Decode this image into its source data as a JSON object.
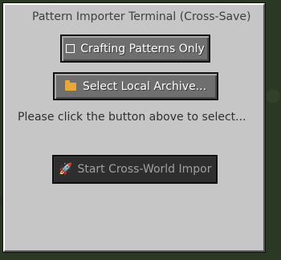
{
  "window": {
    "title": "Pattern Importer Terminal (Cross-Save)"
  },
  "buttons": {
    "toggle_label": "Crafting Patterns Only",
    "select_label": "Select Local Archive...",
    "start_label": "Start Cross-World Impor"
  },
  "status": {
    "text": "Please click the button above to select..."
  },
  "icons": {
    "toggle": "checkbox-icon",
    "select": "folder-icon",
    "start": "rocket-icon"
  },
  "colors": {
    "panel": "#c6c6c6",
    "button": "#6f6f6f",
    "button_disabled": "#2e2e2e",
    "folder": "#e8a838"
  }
}
